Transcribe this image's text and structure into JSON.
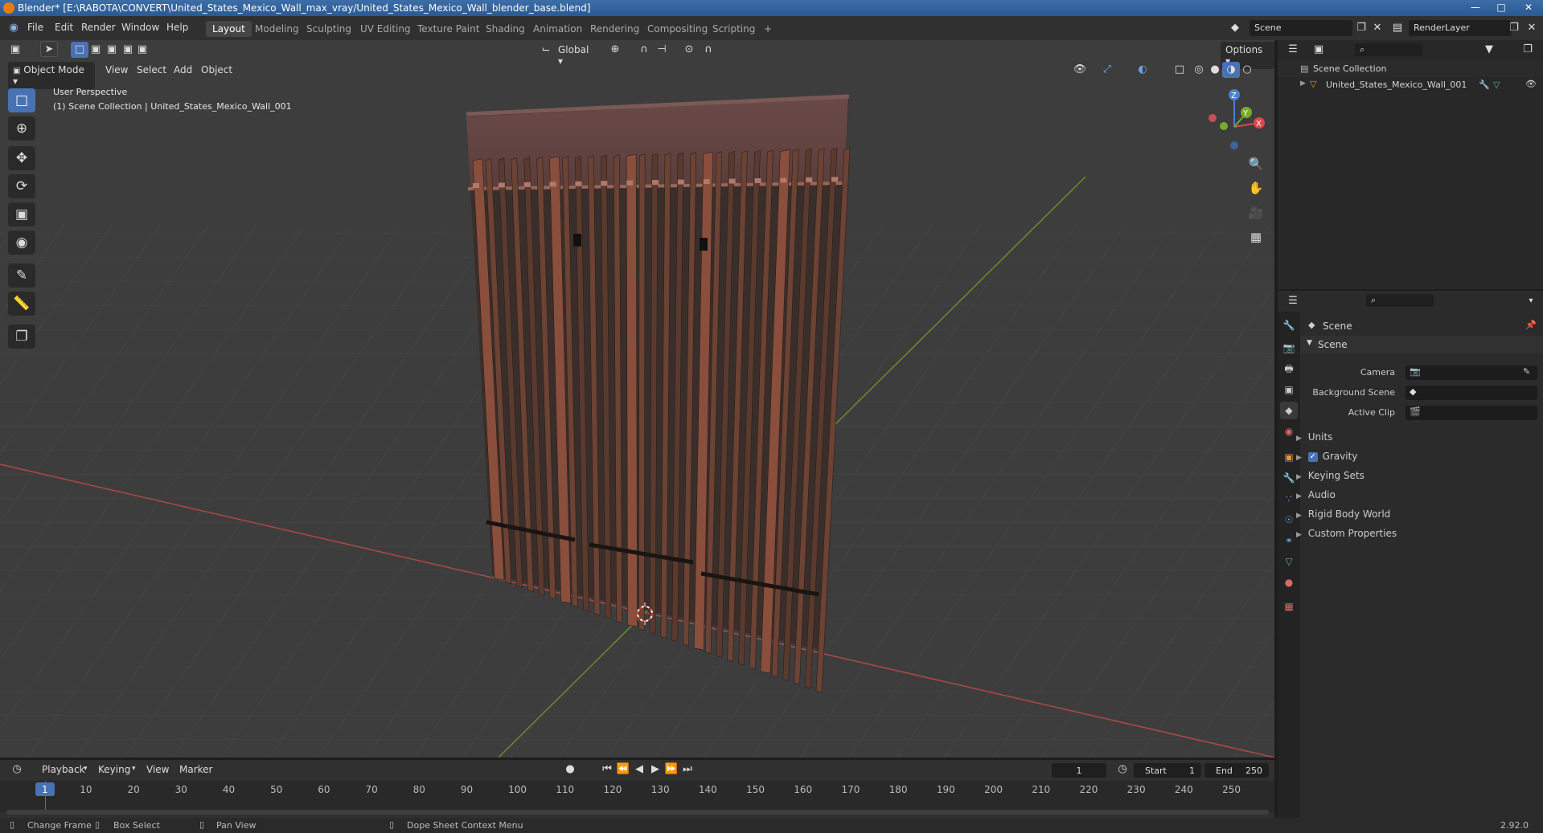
{
  "window": {
    "title": "Blender* [E:\\RABOTA\\CONVERT\\United_States_Mexico_Wall_max_vray/United_States_Mexico_Wall_blender_base.blend]"
  },
  "menu": [
    "File",
    "Edit",
    "Render",
    "Window",
    "Help"
  ],
  "workspaces": [
    "Layout",
    "Modeling",
    "Sculpting",
    "UV Editing",
    "Texture Paint",
    "Shading",
    "Animation",
    "Rendering",
    "Compositing",
    "Scripting"
  ],
  "active_workspace": "Layout",
  "scene_field": "Scene",
  "render_layer": "RenderLayer",
  "viewport": {
    "mode": "Object Mode",
    "menus": [
      "View",
      "Select",
      "Add",
      "Object"
    ],
    "transform_orientation": "Global",
    "options_label": "Options",
    "overlay_line1": "User Perspective",
    "overlay_line2": "(1) Scene Collection | United_States_Mexico_Wall_001",
    "gizmo_axes": [
      "Z",
      "Y",
      "X"
    ]
  },
  "outliner": {
    "root": "Scene Collection",
    "item": "United_States_Mexico_Wall_001"
  },
  "properties": {
    "header": "Scene",
    "section": "Scene",
    "camera_label": "Camera",
    "background_scene_label": "Background Scene",
    "active_clip_label": "Active Clip",
    "panels": [
      "Units",
      "Gravity",
      "Keying Sets",
      "Audio",
      "Rigid Body World",
      "Custom Properties"
    ],
    "gravity_checked": true
  },
  "timeline": {
    "menus": [
      "Playback",
      "Keying",
      "View",
      "Marker"
    ],
    "current_frame": "1",
    "start_label": "Start",
    "start_value": "1",
    "end_label": "End",
    "end_value": "250",
    "ticks": [
      "1",
      "10",
      "20",
      "30",
      "40",
      "50",
      "60",
      "70",
      "80",
      "90",
      "100",
      "110",
      "120",
      "130",
      "140",
      "150",
      "160",
      "170",
      "180",
      "190",
      "200",
      "210",
      "220",
      "230",
      "240",
      "250"
    ]
  },
  "statusbar": {
    "change_frame": "Change Frame",
    "box_select": "Box Select",
    "pan_view": "Pan View",
    "context_menu": "Dope Sheet Context Menu",
    "version": "2.92.0"
  },
  "colors": {
    "accent": "#4772b3",
    "x_axis": "#c94a4a",
    "y_axis": "#6d9a2a",
    "wall_rust": "#7a4a3a"
  }
}
